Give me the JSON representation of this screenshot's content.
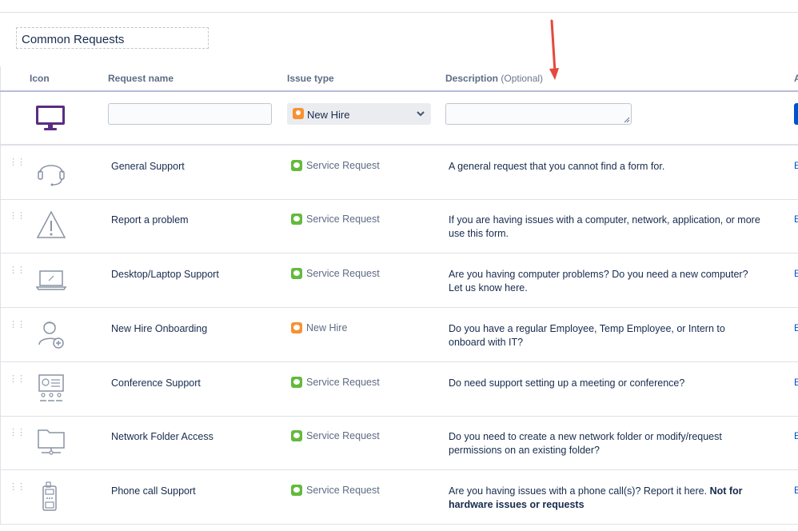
{
  "group": {
    "title": "Common Requests"
  },
  "headers": {
    "icon": "Icon",
    "request_name": "Request name",
    "issue_type": "Issue type",
    "description": "Description",
    "description_optional": "(Optional)",
    "actions_partial": "A"
  },
  "new_row": {
    "request_name_value": "",
    "issue_type_selected": "New Hire",
    "description_value": "",
    "icon": "monitor-icon"
  },
  "rows": [
    {
      "name": "General Support",
      "issue_type": "Service Request",
      "issue_color": "#63ba3c",
      "description": "A general request that you cannot find a form for.",
      "icon": "headset-icon",
      "edit": "E"
    },
    {
      "name": "Report a problem",
      "issue_type": "Service Request",
      "issue_color": "#63ba3c",
      "description": "If you are having issues with a computer, network, application, or more use this form.",
      "icon": "warning-icon",
      "edit": "E"
    },
    {
      "name": "Desktop/Laptop Support",
      "issue_type": "Service Request",
      "issue_color": "#63ba3c",
      "description": "Are you having computer problems? Do you need a new computer? Let us know here.",
      "icon": "laptop-icon",
      "edit": "E"
    },
    {
      "name": "New Hire Onboarding",
      "issue_type": "New Hire",
      "issue_color": "#f79232",
      "description": "Do you have a regular Employee, Temp Employee, or Intern to onboard with IT?",
      "icon": "add-user-icon",
      "edit": "E"
    },
    {
      "name": "Conference Support",
      "issue_type": "Service Request",
      "issue_color": "#63ba3c",
      "description": "Do need support setting up a meeting or conference?",
      "icon": "presentation-icon",
      "edit": "E"
    },
    {
      "name": "Network Folder Access",
      "issue_type": "Service Request",
      "issue_color": "#63ba3c",
      "description": "Do you need to create a new network folder or modify/request permissions on an existing folder?",
      "icon": "network-folder-icon",
      "edit": "E"
    },
    {
      "name": "Phone call Support",
      "issue_type": "Service Request",
      "issue_color": "#63ba3c",
      "description": "Are you having issues with a phone call(s)? Report it here.",
      "description_bold": "Not for hardware issues or requests",
      "icon": "phone-icon",
      "edit": "E"
    }
  ],
  "colors": {
    "accent": "#0052cc",
    "arrow": "#e5493a",
    "service_request": "#63ba3c",
    "new_hire": "#f79232"
  }
}
